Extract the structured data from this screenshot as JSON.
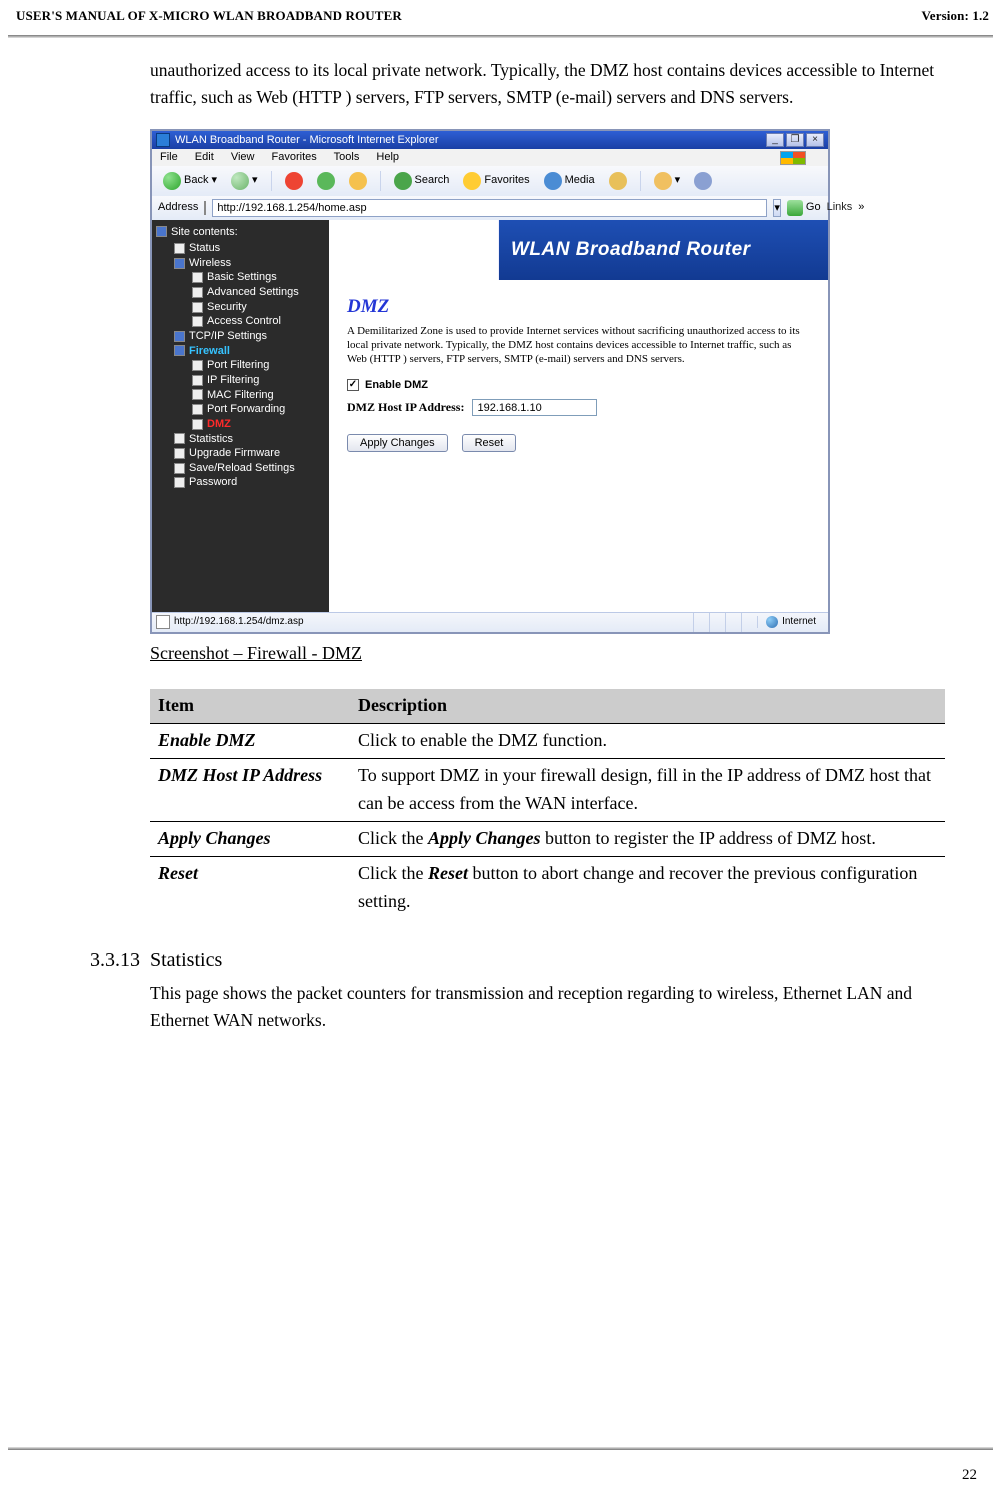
{
  "header": {
    "left": "USER'S MANUAL OF X-MICRO WLAN BROADBAND ROUTER",
    "right": "Version: 1.2"
  },
  "page_number": "22",
  "intro_paragraph": "unauthorized access to its local private network. Typically, the DMZ host contains devices accessible to Internet traffic, such as Web (HTTP ) servers, FTP servers, SMTP (e-mail) servers and DNS servers.",
  "screenshot": {
    "window_title": "WLAN Broadband Router - Microsoft Internet Explorer",
    "menus": [
      "File",
      "Edit",
      "View",
      "Favorites",
      "Tools",
      "Help"
    ],
    "toolbar": {
      "back": "Back",
      "search": "Search",
      "favorites": "Favorites",
      "media": "Media"
    },
    "addressbar": {
      "label": "Address",
      "value": "http://192.168.1.254/home.asp",
      "go": "Go",
      "links": "Links"
    },
    "banner_title": "WLAN Broadband Router",
    "tree": {
      "root": "Site contents:",
      "items": [
        "Status",
        "Wireless"
      ],
      "wireless_sub": [
        "Basic Settings",
        "Advanced Settings",
        "Security",
        "Access Control"
      ],
      "items2": [
        "TCP/IP Settings"
      ],
      "firewall": "Firewall",
      "firewall_sub": [
        "Port Filtering",
        "IP Filtering",
        "MAC Filtering",
        "Port Forwarding"
      ],
      "firewall_active": "DMZ",
      "items3": [
        "Statistics",
        "Upgrade Firmware",
        "Save/Reload Settings",
        "Password"
      ]
    },
    "page": {
      "heading": "DMZ",
      "desc": "A Demilitarized Zone is used to provide Internet services without sacrificing unauthorized access to its local private network. Typically, the DMZ host contains devices accessible to Internet traffic, such as Web (HTTP ) servers, FTP servers, SMTP (e-mail) servers and DNS servers.",
      "enable_label": "Enable DMZ",
      "ip_label": "DMZ Host IP Address:",
      "ip_value": "192.168.1.10",
      "apply_btn": "Apply Changes",
      "reset_btn": "Reset"
    },
    "statusbar": {
      "url": "http://192.168.1.254/dmz.asp",
      "zone": "Internet"
    }
  },
  "caption": "Screenshot – Firewall - DMZ",
  "table": {
    "headers": [
      "Item",
      "Description"
    ],
    "rows": [
      {
        "item": "Enable DMZ",
        "desc_plain": "Click to enable the DMZ function."
      },
      {
        "item": "DMZ Host IP Address",
        "desc_plain": "To support DMZ in your firewall design, fill in the IP address of DMZ host that can be access from the WAN interface."
      },
      {
        "item": "Apply Changes",
        "desc_pre": "Click the ",
        "desc_em": "Apply Changes",
        "desc_post": " button to register the IP address of DMZ host."
      },
      {
        "item": "Reset",
        "desc_pre": "Click the ",
        "desc_em": "Reset",
        "desc_post": " button to abort change and recover the previous configuration setting."
      }
    ]
  },
  "section": {
    "number": "3.3.13",
    "title": "Statistics",
    "body": "This page shows the packet counters for transmission and reception regarding to wireless, Ethernet LAN and Ethernet WAN networks."
  }
}
